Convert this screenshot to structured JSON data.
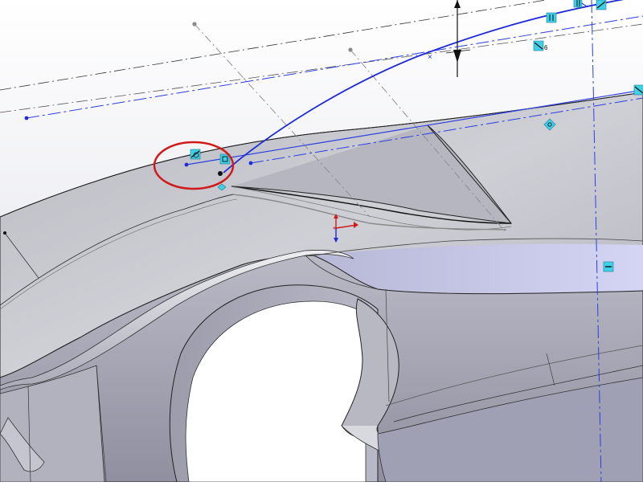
{
  "viewport": {
    "background_top": "#ffffff",
    "background_bottom": "#dcdde6"
  },
  "colors": {
    "sketch_blue": "#1f2bd6",
    "centerline_blue": "#2c3fe0",
    "construction_gray": "#8a8a8a",
    "dim_black": "#111111",
    "relation_cyan": "#3fd0e8",
    "highlight_red": "#d11a1a",
    "body_light": "#c9c9d2",
    "body_mid": "#a9a9b5",
    "body_dark": "#7f7f8e",
    "body_tint": "#c8c8ef"
  },
  "relations": {
    "symbols": [
      {
        "id": "tangent-relation",
        "icon": "tangent-icon",
        "label": ""
      },
      {
        "id": "merge-relation",
        "icon": "merge-icon",
        "label": ""
      },
      {
        "id": "parallel-top",
        "icon": "parallel-icon",
        "label": ""
      },
      {
        "id": "coincident-top",
        "icon": "coincident-icon",
        "label": ""
      },
      {
        "id": "tangent-relation-6",
        "icon": "tangent-icon",
        "label": "6"
      },
      {
        "id": "parallel-edge",
        "icon": "parallel-icon",
        "label": ""
      },
      {
        "id": "pierce-relation",
        "icon": "pierce-icon",
        "label": ""
      },
      {
        "id": "horizontal-relation",
        "icon": "horizontal-icon",
        "label": ""
      },
      {
        "id": "edge-relation-right",
        "icon": "tangent-icon",
        "label": ""
      }
    ]
  },
  "annotations": {
    "highlight": "red-ellipse-around-spline-endpoint",
    "triad": "origin-triad"
  }
}
